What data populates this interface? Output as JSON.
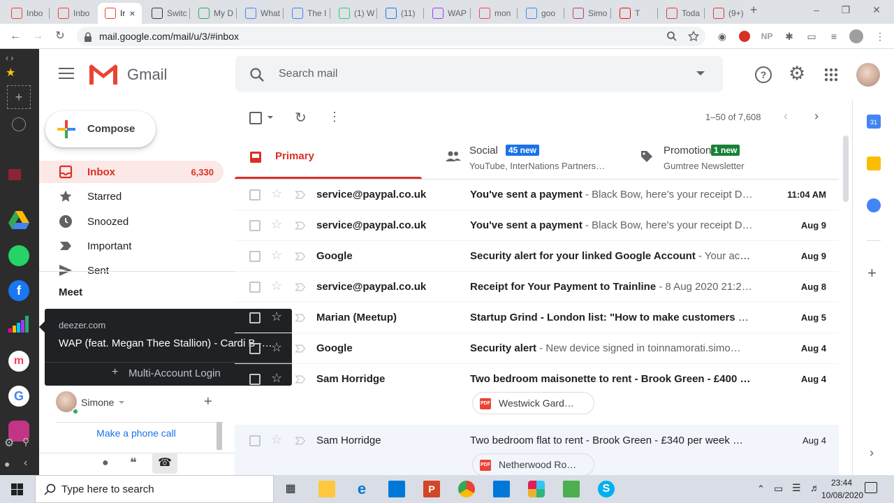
{
  "browser": {
    "tabs": [
      {
        "label": "Inbo",
        "icon": "gmail-icon",
        "color": "#ea4335"
      },
      {
        "label": "Inbo",
        "icon": "gmail-icon",
        "color": "#ea4335"
      },
      {
        "label": "Ir",
        "icon": "gmail-icon",
        "color": "#ea4335",
        "active": true
      },
      {
        "label": "Switc",
        "icon": "switch-icon",
        "color": "#333333"
      },
      {
        "label": "My D",
        "icon": "google-drive-icon",
        "color": "#34a853"
      },
      {
        "label": "What",
        "icon": "google-docs-icon",
        "color": "#4285f4"
      },
      {
        "label": "The I",
        "icon": "google-docs-icon",
        "color": "#4285f4"
      },
      {
        "label": "(1) W",
        "icon": "whatsapp-icon",
        "color": "#25d366"
      },
      {
        "label": "(11)",
        "icon": "facebook-icon",
        "color": "#1877f2"
      },
      {
        "label": "WAP",
        "icon": "deezer-icon",
        "color": "#a238ff"
      },
      {
        "label": "mon",
        "icon": "monday-icon",
        "color": "#ff3d57"
      },
      {
        "label": "goo",
        "icon": "google-icon",
        "color": "#4285f4"
      },
      {
        "label": "Simo",
        "icon": "instagram-icon",
        "color": "#c13584"
      },
      {
        "label": "T",
        "icon": "youtube-icon",
        "color": "#ff0000"
      },
      {
        "label": "Toda",
        "icon": "todoist-icon",
        "color": "#db4035"
      },
      {
        "label": "(9+)",
        "icon": "notification-icon",
        "color": "#e53935"
      }
    ],
    "url": "mail.google.com/mail/u/3/#inbox",
    "ext_np": "NP"
  },
  "gmail": {
    "logo_text": "Gmail",
    "search_placeholder": "Search mail",
    "compose_label": "Compose",
    "nav": [
      {
        "label": "Inbox",
        "count": "6,330",
        "active": true,
        "icon": "inbox-icon"
      },
      {
        "label": "Starred",
        "count": "",
        "icon": "star-icon"
      },
      {
        "label": "Snoozed",
        "count": "",
        "icon": "clock-icon"
      },
      {
        "label": "Important",
        "count": "",
        "icon": "important-icon"
      },
      {
        "label": "Sent",
        "count": "",
        "icon": "send-icon"
      }
    ],
    "meet_label": "Meet",
    "tooltip": {
      "site": "deezer.com",
      "track": "WAP (feat. Megan Thee Stallion) - Cardi B -…",
      "action": "Multi-Account Login"
    },
    "hangouts_user": "Simone",
    "phone_call_label": "Make a phone call",
    "pagination": "1–50 of 7,608",
    "categories": [
      {
        "label": "Primary",
        "badge": "",
        "sub": "",
        "icon": "inbox-icon"
      },
      {
        "label": "Social",
        "badge": "45 new",
        "badge_color": "#1a73e8",
        "sub": "YouTube, InterNations Partners…",
        "icon": "people-icon"
      },
      {
        "label": "Promotions",
        "badge": "1 new",
        "badge_color": "#188038",
        "sub": "Gumtree Newsletter",
        "icon": "tag-icon"
      }
    ],
    "emails": [
      {
        "sender": "service@paypal.co.uk",
        "subject": "You've sent a payment",
        "snippet": " - Black Bow, here's your receipt D…",
        "date": "11:04 AM"
      },
      {
        "sender": "service@paypal.co.uk",
        "subject": "You've sent a payment",
        "snippet": " - Black Bow, here's your receipt D…",
        "date": "Aug 9"
      },
      {
        "sender": "Google",
        "subject": "Security alert for your linked Google Account",
        "snippet": " - Your acc…",
        "date": "Aug 9"
      },
      {
        "sender": "service@paypal.co.uk",
        "subject": "Receipt for Your Payment to Trainline",
        "snippet": " - 8 Aug 2020 21:2…",
        "date": "Aug 8"
      },
      {
        "sender": "Marian (Meetup)",
        "subject": "Startup Grind - London list: \"How to make customers br…",
        "snippet": "",
        "date": "Aug 5"
      },
      {
        "sender": "Google",
        "subject": "Security alert",
        "snippet": " - New device signed in toinnamorati.simo…",
        "date": "Aug 4"
      },
      {
        "sender": "Sam Horridge",
        "subject": "Two bedroom maisonette to rent - Brook Green - £400 …",
        "snippet": "",
        "date": "Aug 4",
        "attachment": "Westwick Gard…"
      },
      {
        "sender": "Sam Horridge",
        "subject": "Two bedroom flat to rent - Brook Green - £340 per week …",
        "snippet": "",
        "date": "Aug 4",
        "attachment": "Netherwood Ro…",
        "read": true
      }
    ]
  },
  "taskbar": {
    "search_placeholder": "Type here to search",
    "time": "23:44",
    "date": "10/08/2020"
  },
  "colors": {
    "gmail_red": "#d93025",
    "accent_blue": "#1a73e8"
  }
}
